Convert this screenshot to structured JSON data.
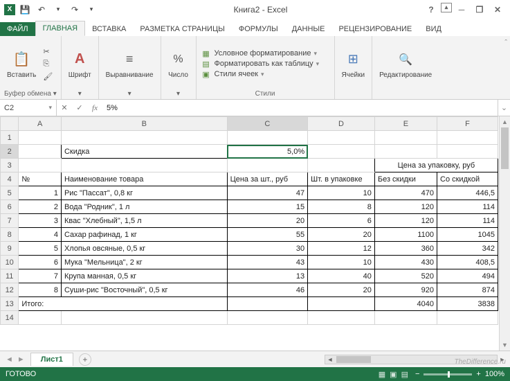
{
  "app": {
    "title": "Книга2 - Excel"
  },
  "qat": {
    "save": "💾",
    "undo": "↶",
    "redo": "↷",
    "more": "▾"
  },
  "win": {
    "help": "?",
    "ribbon": "⌃",
    "min": "─",
    "max": "❐",
    "close": "✕"
  },
  "tabs": {
    "file": "ФАЙЛ",
    "home": "ГЛАВНАЯ",
    "insert": "ВСТАВКА",
    "layout": "РАЗМЕТКА СТРАНИЦЫ",
    "formulas": "ФОРМУЛЫ",
    "data": "ДАННЫЕ",
    "review": "РЕЦЕНЗИРОВАНИЕ",
    "view": "ВИД"
  },
  "ribbon": {
    "clipboard": {
      "paste": "Вставить",
      "label": "Буфер обмена"
    },
    "font": {
      "btn": "Шрифт"
    },
    "alignment": {
      "btn": "Выравнивание"
    },
    "number": {
      "btn": "Число"
    },
    "styles": {
      "cond": "Условное форматирование",
      "table": "Форматировать как таблицу",
      "cell": "Стили ячеек",
      "label": "Стили"
    },
    "cells": {
      "btn": "Ячейки"
    },
    "editing": {
      "btn": "Редактирование"
    }
  },
  "fbar": {
    "name": "C2",
    "formula": "5%",
    "cancel": "✕",
    "enter": "✓"
  },
  "cols": [
    "A",
    "B",
    "C",
    "D",
    "E",
    "F"
  ],
  "sheet": {
    "discount_label": "Скидка",
    "discount_value": "5,0%",
    "pack_price_header": "Цена за упаковку, руб",
    "num": "№",
    "name": "Наименование товара",
    "price": "Цена за шт., руб",
    "qty": "Шт. в упаковке",
    "nodisc": "Без скидки",
    "withdisc": "Со скидкой",
    "rows": [
      {
        "n": "1",
        "name": "Рис \"Пассат\", 0,8 кг",
        "p": "47",
        "q": "10",
        "e": "470",
        "f": "446,5"
      },
      {
        "n": "2",
        "name": "Вода \"Родник\", 1 л",
        "p": "15",
        "q": "8",
        "e": "120",
        "f": "114"
      },
      {
        "n": "3",
        "name": "Квас \"Хлебный\", 1,5 л",
        "p": "20",
        "q": "6",
        "e": "120",
        "f": "114"
      },
      {
        "n": "4",
        "name": "Сахар рафинад, 1 кг",
        "p": "55",
        "q": "20",
        "e": "1100",
        "f": "1045"
      },
      {
        "n": "5",
        "name": "Хлопья овсяные, 0,5 кг",
        "p": "30",
        "q": "12",
        "e": "360",
        "f": "342"
      },
      {
        "n": "6",
        "name": "Мука \"Мельница\", 2 кг",
        "p": "43",
        "q": "10",
        "e": "430",
        "f": "408,5"
      },
      {
        "n": "7",
        "name": "Крупа манная, 0,5 кг",
        "p": "13",
        "q": "40",
        "e": "520",
        "f": "494"
      },
      {
        "n": "8",
        "name": "Суши-рис \"Восточный\", 0,5 кг",
        "p": "46",
        "q": "20",
        "e": "920",
        "f": "874"
      }
    ],
    "total": "Итого:",
    "total_e": "4040",
    "total_f": "3838"
  },
  "sheets": {
    "tab1": "Лист1",
    "add": "+"
  },
  "status": {
    "ready": "ГОТОВО",
    "zoom": "100%"
  },
  "watermark": "TheDifference.ru"
}
